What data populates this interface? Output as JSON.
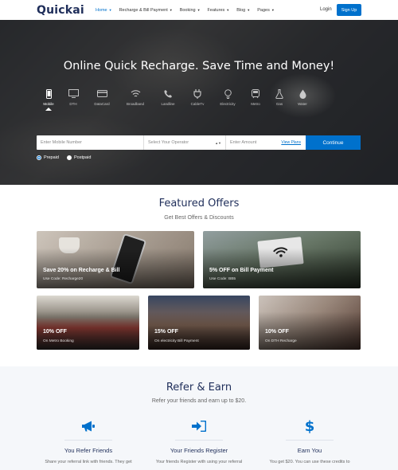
{
  "brand": {
    "logo": "Quickai",
    "accent": "#0071cc",
    "navy": "#1f2e5a"
  },
  "nav": {
    "items": [
      {
        "label": "Home",
        "active": true
      },
      {
        "label": "Recharge & Bill Payment",
        "active": false
      },
      {
        "label": "Booking",
        "active": false
      },
      {
        "label": "Features",
        "active": false
      },
      {
        "label": "Blog",
        "active": false
      },
      {
        "label": "Pages",
        "active": false
      }
    ],
    "login": "Login",
    "signup": "Sign Up"
  },
  "hero": {
    "title": "Online Quick Recharge. Save Time and Money!",
    "services": [
      {
        "label": "Mobile",
        "icon": "mobile-icon",
        "active": true
      },
      {
        "label": "DTH",
        "icon": "tv-icon"
      },
      {
        "label": "DataCard",
        "icon": "credit-card-icon"
      },
      {
        "label": "Broadband",
        "icon": "wifi-icon"
      },
      {
        "label": "Landline",
        "icon": "phone-icon"
      },
      {
        "label": "CableTv",
        "icon": "plug-icon"
      },
      {
        "label": "Electricity",
        "icon": "lightbulb-icon"
      },
      {
        "label": "Metro",
        "icon": "train-icon"
      },
      {
        "label": "Gas",
        "icon": "flask-icon"
      },
      {
        "label": "Water",
        "icon": "water-drop-icon"
      }
    ],
    "form": {
      "mobile_placeholder": "Enter Mobile Number",
      "operator_placeholder": "Select Your Operator",
      "amount_placeholder": "Enter Amount",
      "view_plans": "View Plans",
      "continue": "Continue"
    },
    "plan_types": [
      {
        "label": "Prepaid",
        "selected": true
      },
      {
        "label": "Postpaid",
        "selected": false
      }
    ]
  },
  "featured": {
    "title": "Featured Offers",
    "subtitle": "Get Best Offers & Discounts",
    "offers": [
      {
        "title": "Save 20% on Recharge & Bill",
        "subtitle": "Use Code: Recharge20"
      },
      {
        "title": "5% OFF on Bill Payment",
        "subtitle": "Use Code: BB5"
      },
      {
        "title": "10% OFF",
        "subtitle": "On Metro Booking"
      },
      {
        "title": "15% OFF",
        "subtitle": "On electricity Bill Payment"
      },
      {
        "title": "10% OFF",
        "subtitle": "On DTH Recharge"
      }
    ]
  },
  "refer": {
    "title": "Refer & Earn",
    "subtitle": "Refer your friends and earn up to $20.",
    "steps": [
      {
        "title": "You Refer Friends",
        "desc": "Share your referral link with friends. They get",
        "icon": "bullhorn-icon"
      },
      {
        "title": "Your Friends Register",
        "desc": "Your friends Register with using your referral",
        "icon": "sign-in-icon"
      },
      {
        "title": "Earn You",
        "desc": "You get $20. You can use these credits to",
        "icon": "dollar-icon"
      }
    ]
  }
}
